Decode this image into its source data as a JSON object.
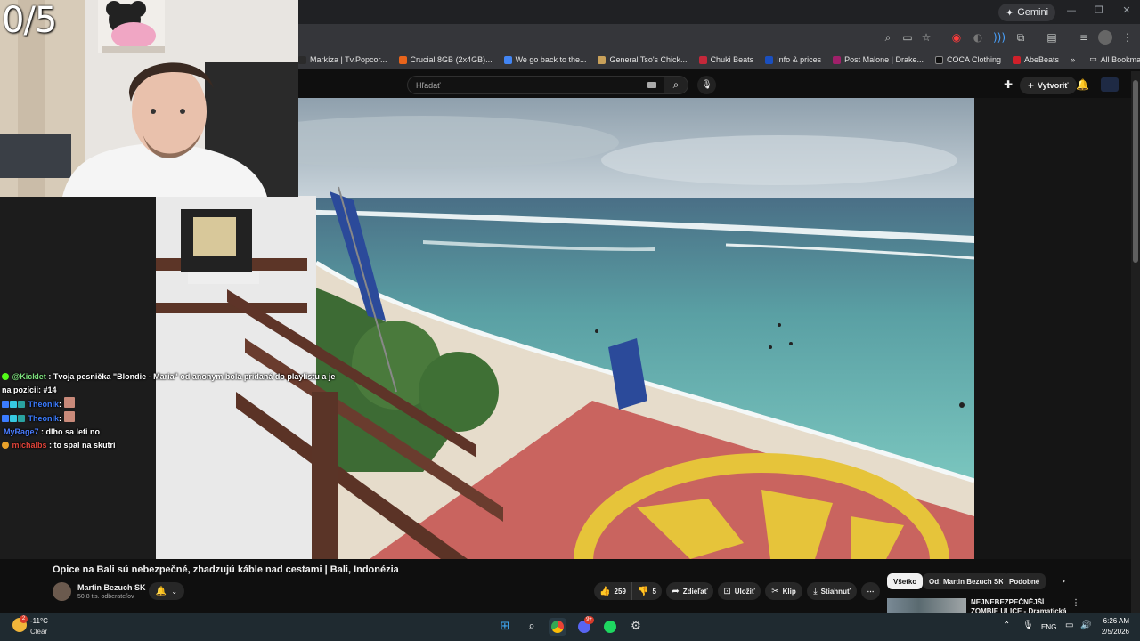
{
  "overlay": {
    "counter": "0/5",
    "chat": [
      {
        "user": "@Kicklet",
        "user_color": "#7ee37e",
        "text": ": Tvoja pesnička \"Blondie - Maria\" od anonym bola pridaná do playlistu a je",
        "text2": "na pozícii: #14"
      },
      {
        "user": "Theonik",
        "user_color": "#3b7cff",
        "text": ":"
      },
      {
        "user": "Theonik",
        "user_color": "#3b7cff",
        "text": ":"
      },
      {
        "user": "MyRage7",
        "user_color": "#4a7dff",
        "text": ": dlho sa leti no"
      },
      {
        "user": "michalbs",
        "user_color": "#e0443a",
        "text": ": to spal na skutri"
      }
    ]
  },
  "browser": {
    "gemini_label": "Gemini",
    "bookmarks": [
      {
        "label": "Markíza | Tv.Popcor...",
        "color": "#2b2b2b"
      },
      {
        "label": "Crucial 8GB (2x4GB)...",
        "color": "#e8641b"
      },
      {
        "label": "We go back to the...",
        "color": "#4285f4"
      },
      {
        "label": "General Tso's Chick...",
        "color": "#c9a15a"
      },
      {
        "label": "Chuki Beats",
        "color": "#c4283a"
      },
      {
        "label": "Info & prices",
        "color": "#1a4fbf"
      },
      {
        "label": "Post Malone | Drake...",
        "color": "#a0206a"
      },
      {
        "label": "COCA Clothing",
        "color": "#111111"
      },
      {
        "label": "AbeBeats",
        "color": "#d0202a"
      }
    ],
    "bookmarks_more": "»",
    "all_bookmarks": "All Bookmarks"
  },
  "youtube": {
    "search_placeholder": "Hľadať",
    "create_label": "Vytvoriť",
    "video_title": "Opice na Bali sú nebezpečné, zhadzujú káble nad cestami | Bali, Indonézia",
    "channel_name": "Martin Bezuch SK",
    "channel_subs": "50,8 tis. odberateľov",
    "likes": "259",
    "dislikes": "5",
    "share_label": "Zdieľať",
    "save_label": "Uložiť",
    "clip_label": "Klip",
    "download_label": "Stiahnuť",
    "more_label": "⋯",
    "chips": [
      "Všetko",
      "Od: Martin Bezuch SK",
      "Podobné"
    ],
    "rec_title": "NEJNEBEZPEČNĚJŠÍ ZOMBIE ULICE - Dramatická Ochranná..."
  },
  "taskbar": {
    "weather_temp": "-11°C",
    "weather_cond": "Clear",
    "weather_badge": "2",
    "lang": "ENG",
    "time": "6:26 AM",
    "date": "2/5/2026",
    "discord_badge": "9+"
  },
  "colors": {
    "accent_red": "#ff0033",
    "chrome_dark": "#202124",
    "toolbar": "#35363a"
  }
}
